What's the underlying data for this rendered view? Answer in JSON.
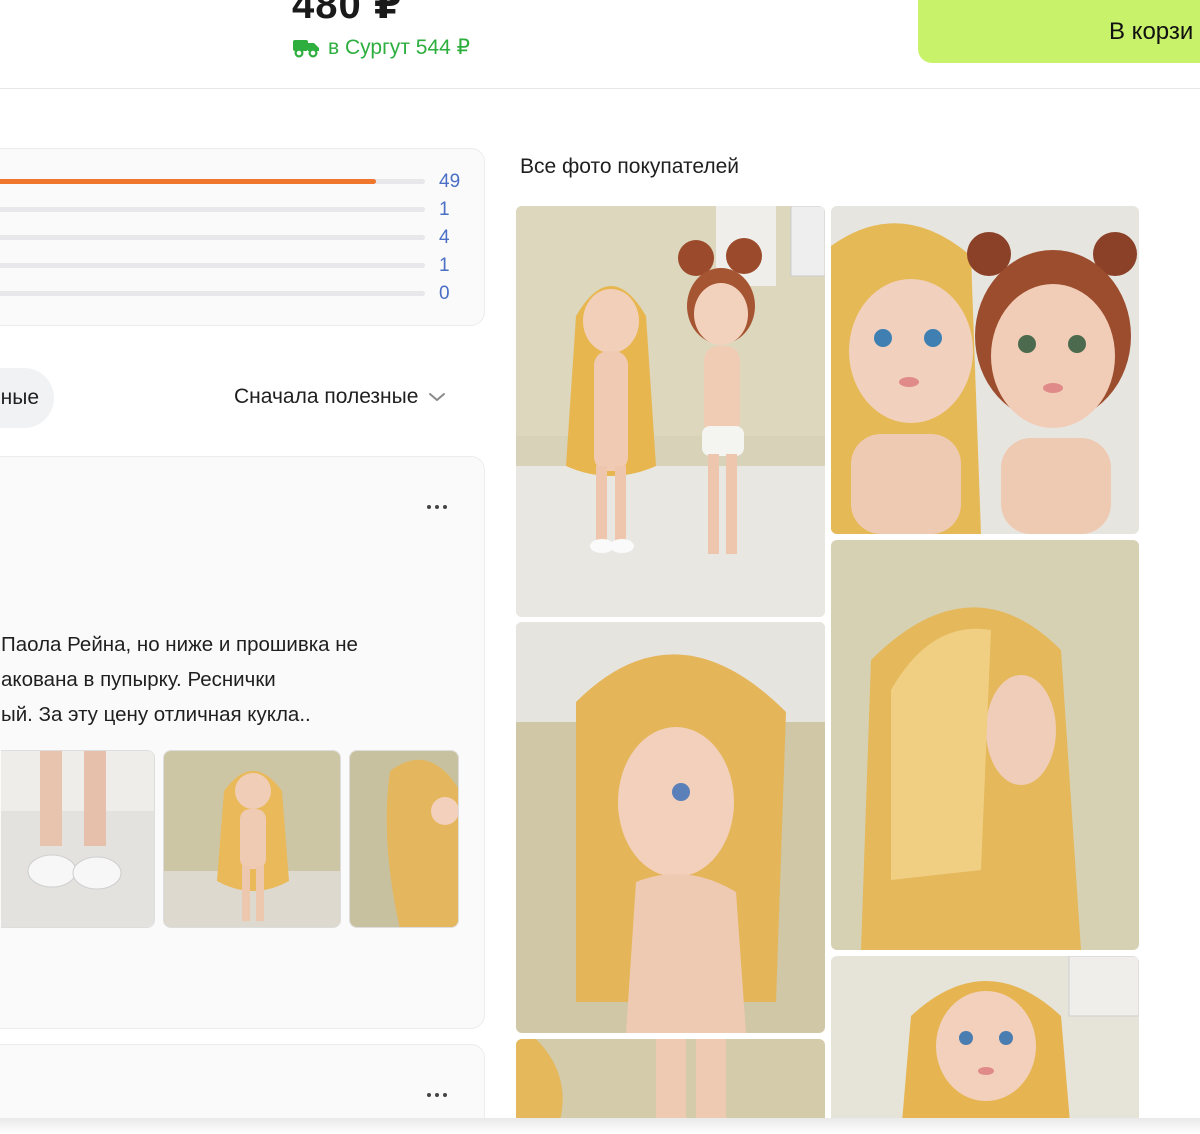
{
  "header": {
    "price": "480 ₽",
    "delivery_text": "в Сургут 544 ₽",
    "delivery_icon": "truck-icon",
    "cart_button_label": "В корзи",
    "accent_green": "#c9f26b",
    "delivery_color": "#2eae3f"
  },
  "rating_histogram": {
    "bar_color": "#f0762e",
    "rows": [
      {
        "count": "49",
        "fraction": 0.89
      },
      {
        "count": "1",
        "fraction": 0
      },
      {
        "count": "4",
        "fraction": 0
      },
      {
        "count": "1",
        "fraction": 0
      },
      {
        "count": "0",
        "fraction": 0
      }
    ]
  },
  "filters": {
    "pill_label": "ные",
    "sort_label": "Сначала полезные",
    "sort_icon": "chevron-down-icon"
  },
  "review": {
    "menu_icon": "more-icon",
    "text_lines": [
      "Паола Рейна, но ниже и прошивка не",
      "акована в пупырку. Реснички",
      "ый. За эту цену отличная кукла.."
    ],
    "photos": [
      "doll-shoes-photo",
      "doll-full-photo",
      "doll-side-photo"
    ]
  },
  "gallery": {
    "title": "Все фото покупателей",
    "photos": [
      "two-dolls-photo",
      "two-dolls-closeup-photo",
      "doll-profile-photo",
      "doll-hair-photo",
      "doll-legs-photo",
      "doll-portrait-photo"
    ]
  }
}
